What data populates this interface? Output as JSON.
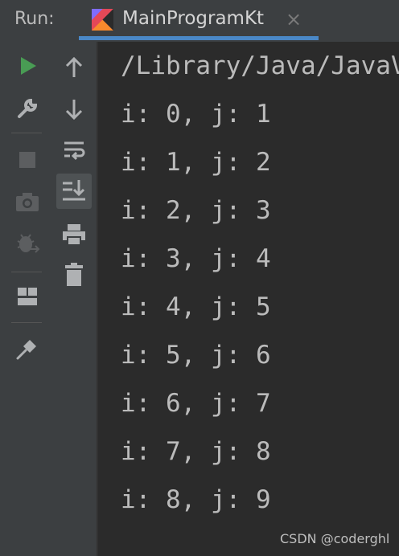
{
  "header": {
    "run_label": "Run:",
    "tab_title": "MainProgramKt",
    "close_glyph": "×"
  },
  "left_toolbar": {
    "items": [
      "rerun-icon",
      "wrench-icon",
      "stop-icon",
      "camera-icon",
      "debug-icon",
      "layout-icon",
      "pin-icon"
    ]
  },
  "console_toolbar": {
    "items": [
      "arrow-up-icon",
      "arrow-down-icon",
      "soft-wrap-icon",
      "scroll-to-end-icon",
      "print-icon",
      "trash-icon"
    ]
  },
  "console": {
    "lines": [
      "/Library/Java/JavaVirtualMachines",
      "i: 0, j: 1",
      "i: 1, j: 2",
      "i: 2, j: 3",
      "i: 3, j: 4",
      "i: 4, j: 5",
      "i: 5, j: 6",
      "i: 6, j: 7",
      "i: 7, j: 8",
      "i: 8, j: 9"
    ]
  },
  "watermark": "CSDN @coderghl",
  "colors": {
    "accent": "#4a88c7",
    "run_green": "#499c54",
    "text": "#bbbbbb",
    "background": "#2b2b2b",
    "toolbar": "#3c3f41"
  }
}
